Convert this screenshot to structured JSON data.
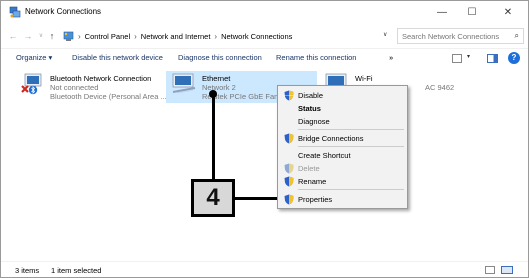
{
  "window": {
    "title": "Network Connections",
    "minimize": "—",
    "maximize": "☐",
    "close": "✕"
  },
  "address": {
    "back": "←",
    "forward": "→",
    "recent": "∨",
    "up": "↑",
    "crumbs": [
      "Control Panel",
      "Network and Internet",
      "Network Connections"
    ],
    "separator": "›",
    "dropdown": "∨",
    "refresh": "↻",
    "search_placeholder": "Search Network Connections",
    "search_icon": "⌕"
  },
  "commands": {
    "organize": "Organize ▾",
    "disable": "Disable this network device",
    "diagnose": "Diagnose this connection",
    "rename": "Rename this connection",
    "more": "»",
    "view_dropdown": "▾",
    "help": "?"
  },
  "connections": [
    {
      "name": "Bluetooth Network Connection",
      "status": "Not connected",
      "device": "Bluetooth Device (Personal Area ..."
    },
    {
      "name": "Ethernet",
      "status": "Network 2",
      "device": "Realtek PCIe GbE Family Controller"
    },
    {
      "name": "Wi-Fi",
      "status": "",
      "device": "AC 9462"
    }
  ],
  "context_menu": {
    "items": [
      {
        "label": "Disable",
        "shield": true,
        "bold": false,
        "disabled": false
      },
      {
        "label": "Status",
        "shield": false,
        "bold": true,
        "disabled": false
      },
      {
        "label": "Diagnose",
        "shield": false,
        "bold": false,
        "disabled": false
      },
      {
        "label": "Bridge Connections",
        "shield": true,
        "bold": false,
        "disabled": false
      },
      {
        "label": "Create Shortcut",
        "shield": false,
        "bold": false,
        "disabled": false
      },
      {
        "label": "Delete",
        "shield": true,
        "bold": false,
        "disabled": true
      },
      {
        "label": "Rename",
        "shield": true,
        "bold": false,
        "disabled": false
      },
      {
        "label": "Properties",
        "shield": true,
        "bold": false,
        "disabled": false
      }
    ]
  },
  "callout": {
    "number": "4"
  },
  "status": {
    "count": "3 items",
    "selected": "1 item selected"
  },
  "colors": {
    "selection": "#cce8ff",
    "link": "#1a3668",
    "accent": "#1e6fd9"
  }
}
